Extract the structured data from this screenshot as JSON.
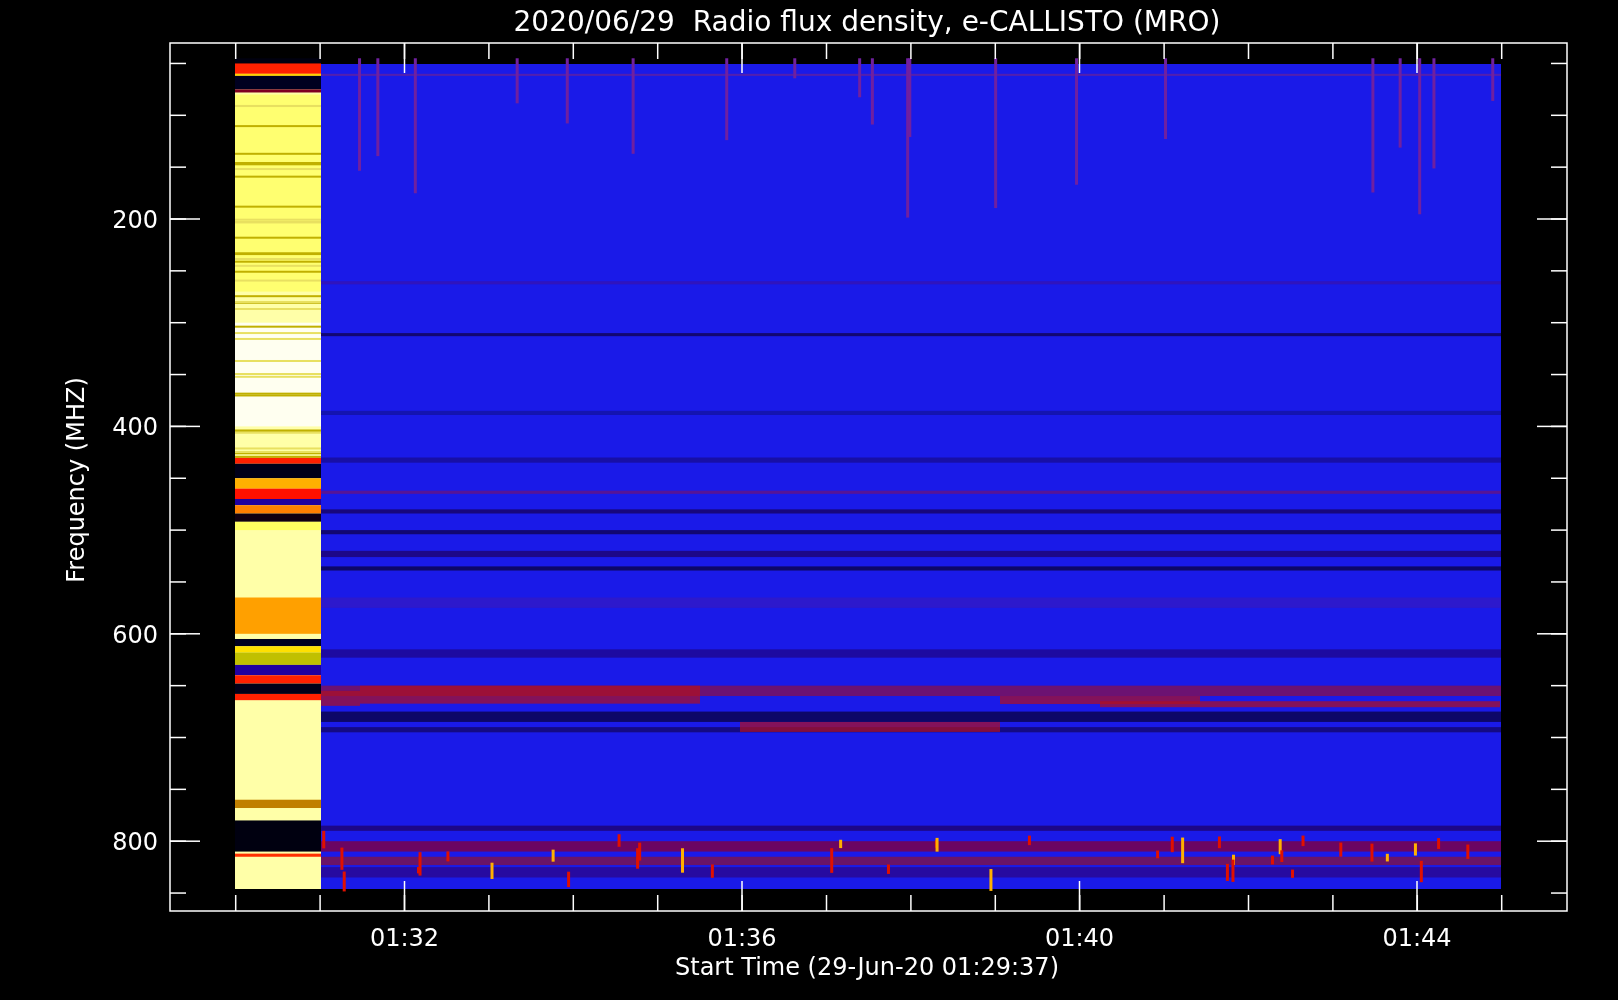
{
  "title": "2020/06/29  Radio flux density, e-CALLISTO (MRO)",
  "plot": {
    "y_axis": {
      "label": "Frequency (MHZ)",
      "ticks": [
        "200",
        "400",
        "600",
        "800"
      ]
    },
    "x_axis": {
      "label": "Start Time (29-Jun-20 01:29:37)",
      "ticks": [
        "01:32",
        "01:36",
        "01:40",
        "01:44"
      ]
    }
  }
}
